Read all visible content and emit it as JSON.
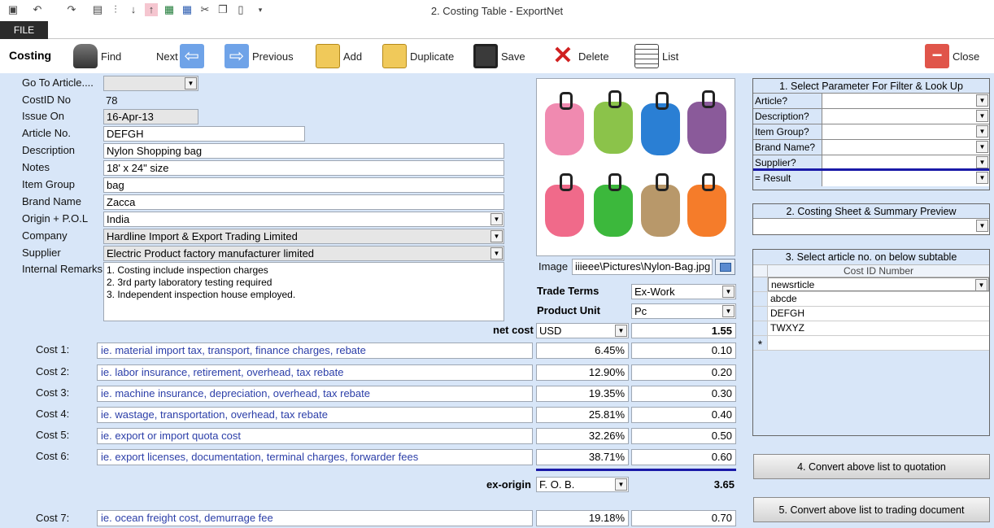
{
  "window": {
    "title": "2. Costing Table - ExportNet"
  },
  "menu": {
    "file": "FILE"
  },
  "toolbar": {
    "tab": "Costing",
    "find": "Find",
    "next": "Next",
    "previous": "Previous",
    "add": "Add",
    "duplicate": "Duplicate",
    "save": "Save",
    "delete": "Delete",
    "list": "List",
    "close": "Close"
  },
  "form": {
    "goto_label": "Go To Article....",
    "goto_value": "",
    "costid_label": "CostID No",
    "costid_value": "78",
    "issue_label": "Issue On",
    "issue_value": "16-Apr-13",
    "article_label": "Article No.",
    "article_value": "DEFGH",
    "desc_label": "Description",
    "desc_value": "Nylon Shopping bag",
    "notes_label": "Notes",
    "notes_value": "18' x 24\" size",
    "group_label": "Item Group",
    "group_value": "bag",
    "brand_label": "Brand Name",
    "brand_value": "Zacca",
    "origin_label": "Origin + P.O.L",
    "origin_value": "India",
    "company_label": "Company",
    "company_value": "Hardline Import & Export Trading Limited",
    "supplier_label": "Supplier",
    "supplier_value": "Electric Product factory manufacturer limited",
    "remarks_label": "Internal Remarks",
    "remarks_lines": [
      "1. Costing include inspection charges",
      "2. 3rd party laboratory testing required",
      "3. Independent inspection house employed."
    ],
    "image_label": "Image",
    "image_value": "iiieee\\Pictures\\Nylon-Bag.jpg",
    "trade_label": "Trade Terms",
    "trade_value": "Ex-Work",
    "unit_label": "Product Unit",
    "unit_value": "Pc",
    "netcost_label": "net cost",
    "currency": "USD",
    "netcost_value": "1.55",
    "exorigin_label": "ex-origin",
    "exorigin_term": "F. O. B.",
    "exorigin_value": "3.65"
  },
  "costs": [
    {
      "label": "Cost 1:",
      "desc": "ie. material import tax, transport, finance charges, rebate",
      "pct": "6.45%",
      "amt": "0.10"
    },
    {
      "label": "Cost 2:",
      "desc": "ie. labor insurance, retirement, overhead, tax rebate",
      "pct": "12.90%",
      "amt": "0.20"
    },
    {
      "label": "Cost 3:",
      "desc": "ie. machine insurance, depreciation, overhead, tax rebate",
      "pct": "19.35%",
      "amt": "0.30"
    },
    {
      "label": "Cost 4:",
      "desc": "ie. wastage, transportation, overhead, tax rebate",
      "pct": "25.81%",
      "amt": "0.40"
    },
    {
      "label": "Cost 5:",
      "desc": "ie. export or import quota cost",
      "pct": "32.26%",
      "amt": "0.50"
    },
    {
      "label": "Cost 6:",
      "desc": "ie. export licenses, documentation, terminal charges, forwarder fees",
      "pct": "38.71%",
      "amt": "0.60"
    },
    {
      "label": "Cost 7:",
      "desc": "ie. ocean freight cost, demurrage fee",
      "pct": "19.18%",
      "amt": "0.70"
    }
  ],
  "filter": {
    "title": "1. Select Parameter For Filter & Look Up",
    "rows": [
      "Article?",
      "Description?",
      "Item Group?",
      "Brand Name?",
      "Supplier?"
    ],
    "result": "= Result"
  },
  "preview": {
    "title": "2. Costing Sheet & Summary Preview"
  },
  "subtable": {
    "title": "3. Select article no.  on below subtable",
    "header": "Cost ID Number",
    "rows": [
      "newsrticle",
      "abcde",
      "DEFGH",
      "TWXYZ"
    ],
    "new_marker": "*"
  },
  "buttons": {
    "quotation": "4. Convert above list to quotation",
    "trading": "5. Convert above list to trading document"
  },
  "colors": {
    "background": "#d8e6f8",
    "accent_line": "#1a1aa8",
    "cost_text": "#2b3ea8"
  }
}
